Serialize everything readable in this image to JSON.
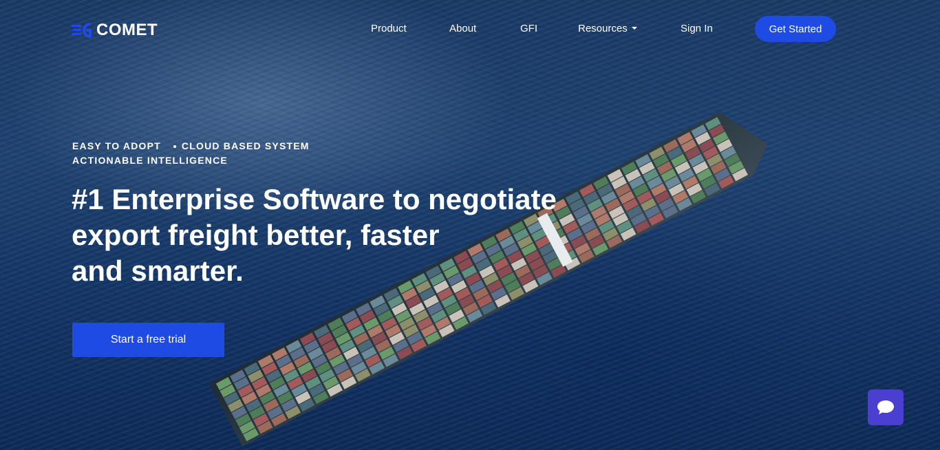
{
  "brand": {
    "name": "COMET",
    "accent": "#1e4be3"
  },
  "nav": {
    "items": [
      {
        "label": "Product"
      },
      {
        "label": "About"
      },
      {
        "label": "GFI"
      },
      {
        "label": "Resources"
      },
      {
        "label": "Sign In"
      }
    ],
    "cta_label": "Get Started"
  },
  "hero": {
    "tags": [
      "EASY TO ADOPT",
      "CLOUD BASED SYSTEM",
      "ACTIONABLE INTELLIGENCE"
    ],
    "headline_lines": [
      "#1 Enterprise Software to negotiate",
      "export freight better, faster",
      "and smarter."
    ],
    "cta_label": "Start a free trial"
  },
  "chat": {
    "icon": "chat-bubble-icon",
    "color": "#4a3fd1"
  }
}
